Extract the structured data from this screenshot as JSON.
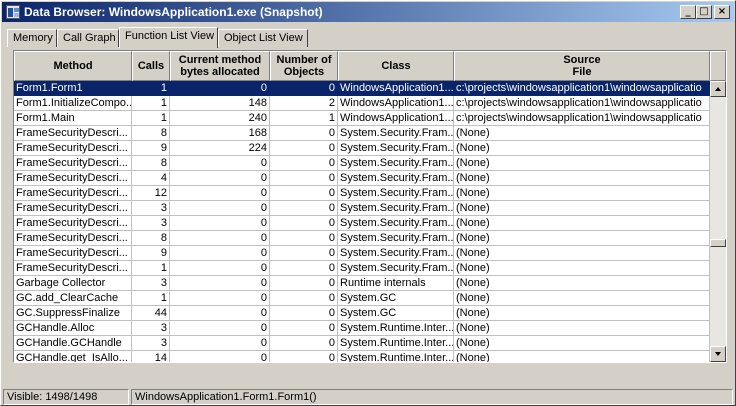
{
  "window": {
    "title": "Data Browser: WindowsApplication1.exe (Snapshot)",
    "minimize_glyph": "_",
    "maximize_glyph": "□",
    "close_glyph": "×"
  },
  "tabs": [
    {
      "label": "Memory",
      "active": false
    },
    {
      "label": "Call Graph",
      "active": false
    },
    {
      "label": "Function List View",
      "active": true
    },
    {
      "label": "Object List View",
      "active": false
    }
  ],
  "grid": {
    "columns": [
      {
        "label": "Method"
      },
      {
        "label": "Calls"
      },
      {
        "label": "Current method\nbytes allocated"
      },
      {
        "label": "Number of\nObjects"
      },
      {
        "label": "Class"
      },
      {
        "label": "Source\nFile"
      }
    ],
    "rows": [
      [
        "Form1.Form1",
        "1",
        "0",
        "0",
        "WindowsApplication1...",
        "c:\\projects\\windowsapplication1\\windowsapplicatio"
      ],
      [
        "Form1.InitializeCompo...",
        "1",
        "148",
        "2",
        "WindowsApplication1...",
        "c:\\projects\\windowsapplication1\\windowsapplicatio"
      ],
      [
        "Form1.Main",
        "1",
        "240",
        "1",
        "WindowsApplication1...",
        "c:\\projects\\windowsapplication1\\windowsapplicatio"
      ],
      [
        "FrameSecurityDescri...",
        "8",
        "168",
        "0",
        "System.Security.Fram...",
        "(None)"
      ],
      [
        "FrameSecurityDescri...",
        "9",
        "224",
        "0",
        "System.Security.Fram...",
        "(None)"
      ],
      [
        "FrameSecurityDescri...",
        "8",
        "0",
        "0",
        "System.Security.Fram...",
        "(None)"
      ],
      [
        "FrameSecurityDescri...",
        "4",
        "0",
        "0",
        "System.Security.Fram...",
        "(None)"
      ],
      [
        "FrameSecurityDescri...",
        "12",
        "0",
        "0",
        "System.Security.Fram...",
        "(None)"
      ],
      [
        "FrameSecurityDescri...",
        "3",
        "0",
        "0",
        "System.Security.Fram...",
        "(None)"
      ],
      [
        "FrameSecurityDescri...",
        "3",
        "0",
        "0",
        "System.Security.Fram...",
        "(None)"
      ],
      [
        "FrameSecurityDescri...",
        "8",
        "0",
        "0",
        "System.Security.Fram...",
        "(None)"
      ],
      [
        "FrameSecurityDescri...",
        "9",
        "0",
        "0",
        "System.Security.Fram...",
        "(None)"
      ],
      [
        "FrameSecurityDescri...",
        "1",
        "0",
        "0",
        "System.Security.Fram...",
        "(None)"
      ],
      [
        "Garbage Collector",
        "3",
        "0",
        "0",
        "Runtime internals",
        "(None)"
      ],
      [
        "GC.add_ClearCache",
        "1",
        "0",
        "0",
        "System.GC",
        "(None)"
      ],
      [
        "GC.SuppressFinalize",
        "44",
        "0",
        "0",
        "System.GC",
        "(None)"
      ],
      [
        "GCHandle.Alloc",
        "3",
        "0",
        "0",
        "System.Runtime.Inter...",
        "(None)"
      ],
      [
        "GCHandle.GCHandle",
        "3",
        "0",
        "0",
        "System.Runtime.Inter...",
        "(None)"
      ],
      [
        "GCHandle.get_IsAllo...",
        "14",
        "0",
        "0",
        "System.Runtime.Inter...",
        "(None)"
      ]
    ],
    "selected_row": 0
  },
  "status": {
    "visible": "Visible: 1498/1498",
    "selection": "WindowsApplication1.Form1.Form1()"
  },
  "colors": {
    "title_start": "#0a246a",
    "title_end": "#a6caf0",
    "selection": "#0a246a",
    "face": "#d4d0c8"
  }
}
